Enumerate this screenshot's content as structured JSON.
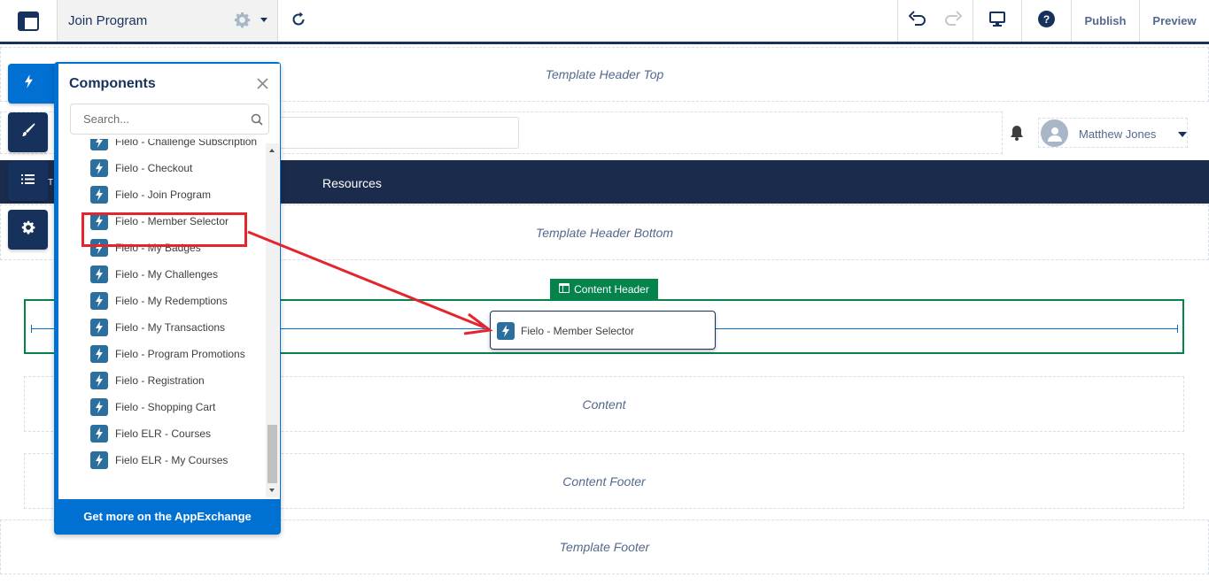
{
  "toolbar": {
    "page_title": "Join Program",
    "publish_label": "Publish",
    "preview_label": "Preview"
  },
  "canvas": {
    "template_header_top": "Template Header Top",
    "template_header_bottom": "Template Header Bottom",
    "content_header_label": "Content Header",
    "content": "Content",
    "content_footer": "Content Footer",
    "template_footer": "Template Footer",
    "nav_items": [
      "Resources"
    ],
    "nav_cut_text": "T",
    "user_name": "Matthew Jones",
    "dragged_component": "Fielo - Member Selector"
  },
  "components_panel": {
    "title": "Components",
    "search_placeholder": "Search...",
    "items": [
      "Fielo - Challenge Subscription",
      "Fielo - Checkout",
      "Fielo - Join Program",
      "Fielo - Member Selector",
      "Fielo - My Badges",
      "Fielo - My Challenges",
      "Fielo - My Redemptions",
      "Fielo - My Transactions",
      "Fielo - Program Promotions",
      "Fielo - Registration",
      "Fielo - Shopping Cart",
      "Fielo ELR - Courses",
      "Fielo ELR - My Courses"
    ],
    "footer_label": "Get more on the AppExchange",
    "highlighted_item": "Fielo - Member Selector"
  },
  "rail": {
    "buttons": [
      "lightning-icon",
      "paintbrush-icon",
      "list-icon",
      "gear-icon"
    ],
    "active": "lightning-icon"
  },
  "colors": {
    "brand_blue": "#0070d2",
    "navy": "#16325c",
    "nav_bar": "#1b2b4b",
    "content_header_green": "#04844b",
    "highlight_red": "#e3262d",
    "component_icon": "#2a6f9e"
  }
}
